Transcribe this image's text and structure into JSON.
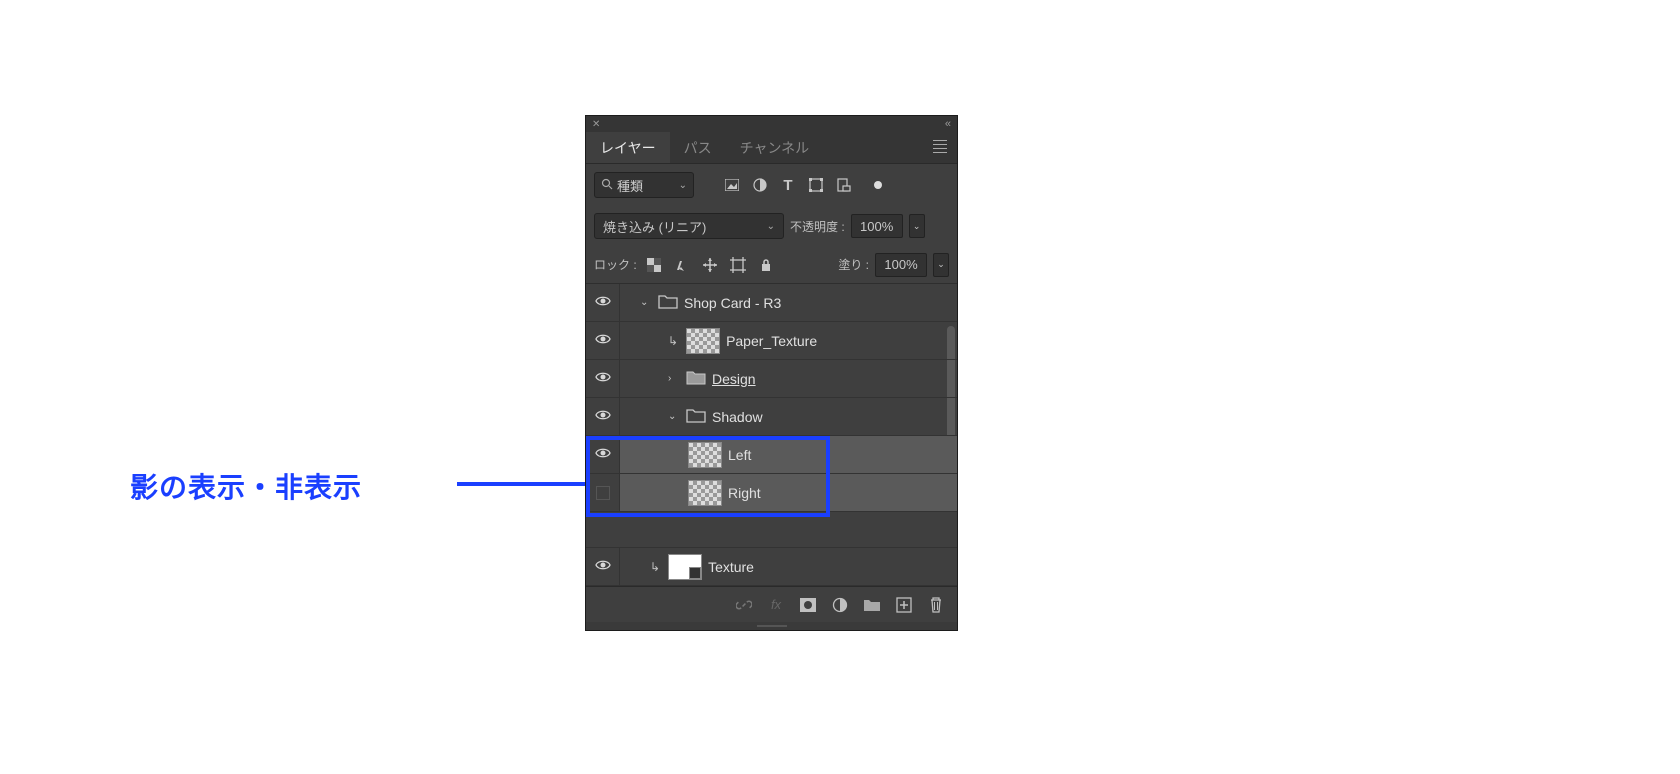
{
  "annotation": {
    "text": "影の表示・非表示"
  },
  "panel": {
    "tabs": {
      "layers": "レイヤー",
      "paths": "パス",
      "channels": "チャンネル"
    },
    "filter": {
      "type": "種類"
    },
    "blend": {
      "mode": "焼き込み (リニア)",
      "opacity_label": "不透明度 :",
      "opacity_value": "100%"
    },
    "lock": {
      "label": "ロック :",
      "fill_label": "塗り :",
      "fill_value": "100%"
    },
    "layers": [
      {
        "name": "Shop Card - R3",
        "type": "group",
        "visible": true,
        "expanded": true
      },
      {
        "name": "Paper_Texture",
        "type": "clipped",
        "visible": true
      },
      {
        "name": "Design",
        "type": "group",
        "visible": true,
        "expanded": false,
        "underlined": true
      },
      {
        "name": "Shadow",
        "type": "group",
        "visible": true,
        "expanded": true
      },
      {
        "name": "Left",
        "type": "layer",
        "visible": true,
        "selected": true
      },
      {
        "name": "Right",
        "type": "layer",
        "visible": false,
        "selected": true
      },
      {
        "name": "Texture",
        "type": "smart",
        "visible": true
      }
    ]
  }
}
